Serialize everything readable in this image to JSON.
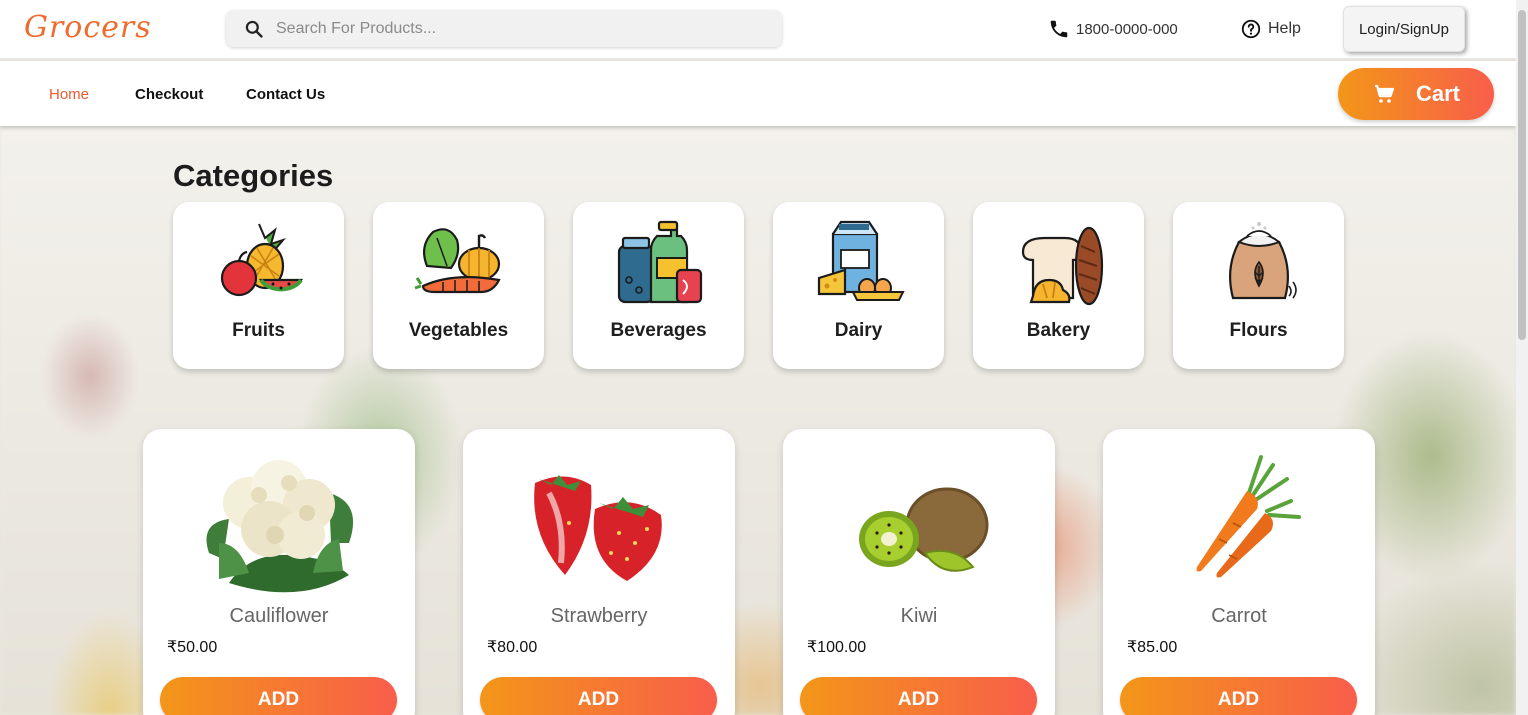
{
  "header": {
    "logo": "Grocers",
    "search_placeholder": "Search For Products...",
    "phone": "1800-0000-000",
    "help": "Help",
    "login": "Login/SignUp"
  },
  "nav": {
    "items": [
      {
        "label": "Home",
        "active": true
      },
      {
        "label": "Checkout",
        "active": false
      },
      {
        "label": "Contact Us",
        "active": false
      }
    ],
    "cart": "Cart"
  },
  "categories": {
    "title": "Categories",
    "items": [
      {
        "label": "Fruits",
        "icon": "fruits-icon"
      },
      {
        "label": "Vegetables",
        "icon": "vegetables-icon"
      },
      {
        "label": "Beverages",
        "icon": "beverages-icon"
      },
      {
        "label": "Dairy",
        "icon": "dairy-icon"
      },
      {
        "label": "Bakery",
        "icon": "bakery-icon"
      },
      {
        "label": "Flours",
        "icon": "flours-icon"
      }
    ]
  },
  "products": [
    {
      "name": "Cauliflower",
      "price": "₹50.00",
      "action": "ADD",
      "image": "cauliflower-image"
    },
    {
      "name": "Strawberry",
      "price": "₹80.00",
      "action": "ADD",
      "image": "strawberry-image"
    },
    {
      "name": "Kiwi",
      "price": "₹100.00",
      "action": "ADD",
      "image": "kiwi-image"
    },
    {
      "name": "Carrot",
      "price": "₹85.00",
      "action": "ADD",
      "image": "carrot-image"
    }
  ],
  "colors": {
    "accent": "#ef5a2d",
    "gradient_start": "#f39619",
    "gradient_end": "#f85e4a"
  }
}
